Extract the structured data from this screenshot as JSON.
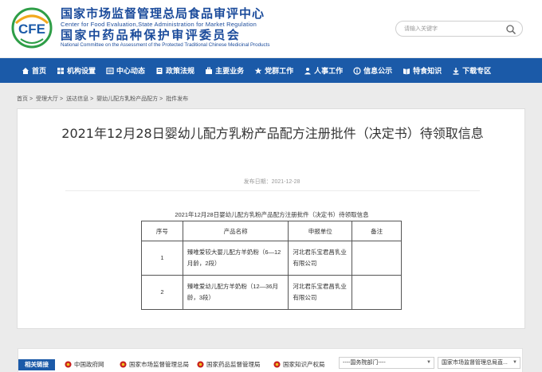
{
  "header": {
    "logo_text": "CFE",
    "org_cn_1": "国家市场监督管理总局食品审评中心",
    "org_en_1": "Center for Food Evaluation,State Administration for Market Regulation",
    "org_cn_2": "国家中药品种保护审评委员会",
    "org_en_2": "National Committee on the Assessment of the Protected Traditional Chinese Medicinal Products",
    "search_placeholder": "请输入关键字"
  },
  "nav": [
    {
      "label": "首页",
      "icon": "home-icon"
    },
    {
      "label": "机构设置",
      "icon": "org-icon"
    },
    {
      "label": "中心动态",
      "icon": "news-icon"
    },
    {
      "label": "政策法规",
      "icon": "policy-icon"
    },
    {
      "label": "主要业务",
      "icon": "business-icon"
    },
    {
      "label": "党群工作",
      "icon": "party-icon"
    },
    {
      "label": "人事工作",
      "icon": "personnel-icon"
    },
    {
      "label": "信息公示",
      "icon": "info-icon"
    },
    {
      "label": "特食知识",
      "icon": "knowledge-icon"
    },
    {
      "label": "下载专区",
      "icon": "download-icon"
    }
  ],
  "breadcrumb": [
    "首页",
    "受理大厅",
    "送达信息",
    "婴幼儿配方乳粉产品配方",
    "批件发布"
  ],
  "article": {
    "title": "2021年12月28日婴幼儿配方乳粉产品配方注册批件（决定书）待领取信息",
    "pub_date": "发布日期：2021-12-28",
    "table_caption": "2021年12月28日婴幼儿配方乳粉产品配方注册批件（决定书）待领取信息",
    "table_headers": [
      "序号",
      "产品名称",
      "申报单位",
      "备注"
    ],
    "rows": [
      {
        "no": "1",
        "product": "臻唯爱较大婴儿配方羊奶粉（6—12月龄，2段）",
        "unit": "河北君乐宝君昌乳业有限公司",
        "note": ""
      },
      {
        "no": "2",
        "product": "臻唯爱幼儿配方羊奶粉（12—36月龄，3段）",
        "unit": "河北君乐宝君昌乳业有限公司",
        "note": ""
      }
    ]
  },
  "footer": {
    "label": "相关链接",
    "links": [
      "中国政府网",
      "国家市场监督管理总局",
      "国家药品监督管理局",
      "国家知识产权局"
    ],
    "select1": "----国务院部门----",
    "select2": "国家市场监督管理总局直..."
  },
  "colors": {
    "brand_blue": "#1b5aa8",
    "logo_green": "#2e9e47",
    "emblem_red": "#c8201e"
  }
}
